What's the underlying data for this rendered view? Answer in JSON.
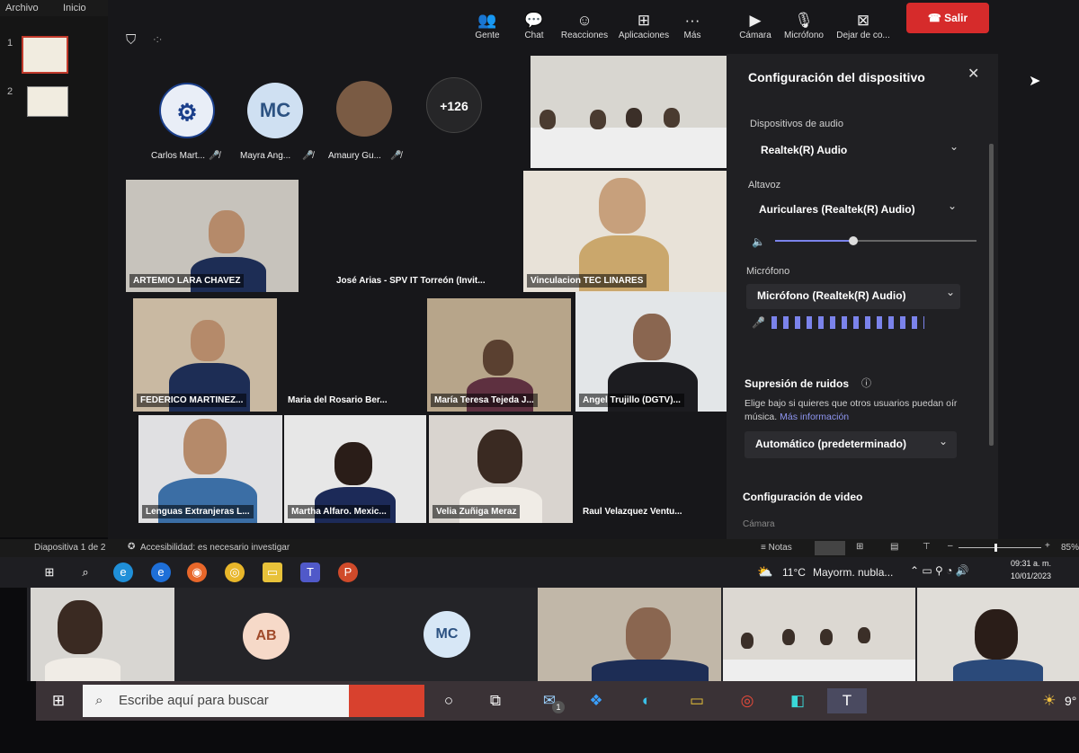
{
  "ppt": {
    "menu_file": "Archivo",
    "menu_home": "Inicio",
    "slide1_num": "1",
    "slide2_num": "2"
  },
  "toolbar": {
    "people": "Gente",
    "chat": "Chat",
    "reactions": "Reacciones",
    "apps": "Aplicaciones",
    "more": "Más",
    "camera": "Cámara",
    "mic": "Micrófono",
    "share": "Dejar de co...",
    "leave": "Salir"
  },
  "avatars": [
    {
      "name": "Carlos Mart...",
      "initials": ""
    },
    {
      "name": "Mayra Ang...",
      "initials": "MC"
    },
    {
      "name": "Amaury Gu...",
      "initials": ""
    },
    {
      "name": "",
      "initials": "+126"
    }
  ],
  "tiles": {
    "t1": "ARTEMIO LARA CHAVEZ",
    "t2": "José Arias - SPV IT Torreón (Invit...",
    "t3": "Vinculacion TEC LINARES",
    "t4": "FEDERICO MARTINEZ...",
    "t5": "Maria del Rosario Ber...",
    "t6": "María Teresa Tejeda J...",
    "t7": "Angel Trujillo (DGTV)...",
    "t8": "Lenguas Extranjeras L...",
    "t9": "Martha Alfaro. Mexic...",
    "t10": "Velia Zuñiga Meraz",
    "t11": "Raul Velazquez Ventu..."
  },
  "panel": {
    "title": "Configuración del dispositivo",
    "audio_label": "Dispositivos de audio",
    "audio_value": "Realtek(R) Audio",
    "speaker_label": "Altavoz",
    "speaker_value": "Auriculares (Realtek(R) Audio)",
    "mic_label": "Micrófono",
    "mic_value": "Micrófono (Realtek(R) Audio)",
    "noise_title": "Supresión de ruidos",
    "noise_desc": "Elige bajo si quieres que otros usuarios puedan oír música.",
    "more_info": "Más información",
    "noise_value": "Automático (predeterminado)",
    "video_title": "Configuración de video",
    "video_partial": "Cámara"
  },
  "status": {
    "slide": "Diapositiva 1 de 2",
    "accessibility": "Accesibilidad: es necesario investigar",
    "notes": "Notas",
    "zoom": "85%"
  },
  "weather": {
    "temp": "11°C",
    "desc": "Mayorm. nubla...",
    "time": "09:31 a. m.",
    "date": "10/01/2023"
  },
  "gallery": {
    "ab": "AB",
    "mc": "MC"
  },
  "taskbar": {
    "search_placeholder": "Escribe aquí para buscar",
    "badge": "1",
    "temp": "9°"
  }
}
